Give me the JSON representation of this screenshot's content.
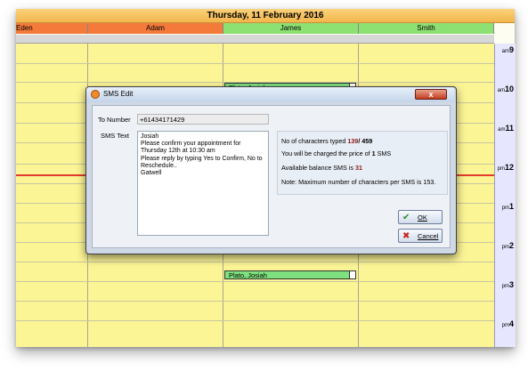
{
  "calendar": {
    "date_title": "Thursday, 11 February 2016",
    "staff": [
      {
        "name": "Eden",
        "color": "#f47a3c"
      },
      {
        "name": "Adam",
        "color": "#f47a3c"
      },
      {
        "name": "James",
        "color": "#8de072"
      },
      {
        "name": "Smith",
        "color": "#8de072"
      }
    ],
    "times": [
      {
        "ampm": "am",
        "hour": "9"
      },
      {
        "ampm": "am",
        "hour": "10"
      },
      {
        "ampm": "am",
        "hour": "11"
      },
      {
        "ampm": "pm",
        "hour": "12"
      },
      {
        "ampm": "pm",
        "hour": "1"
      },
      {
        "ampm": "pm",
        "hour": "2"
      },
      {
        "ampm": "pm",
        "hour": "3"
      },
      {
        "ampm": "pm",
        "hour": "4"
      }
    ],
    "appointments": [
      {
        "label": "Plato, Josiah"
      },
      {
        "label": "Plato, Josiah"
      }
    ]
  },
  "dialog": {
    "title": "SMS Edit",
    "close_label": "x",
    "to_number_label": "To Number",
    "to_number_value": "+61434171429",
    "sms_text_label": "SMS Text",
    "sms_text": "Josiah\nPlease confirm your appointment for Thursday 12th at 10:30 am\nPlease reply by typing Yes to Confirm, No to Reschedule..\nGatwell",
    "info": {
      "chars_label": "No of characters typed",
      "chars_typed": "139",
      "chars_max": "/ 459",
      "charge_prefix": "You will be charged the price of",
      "charge_count": "1",
      "charge_suffix": "SMS",
      "balance_label": "Available balance SMS is",
      "balance_value": "31",
      "note": "Note: Maximum number of characters per SMS is 153."
    },
    "ok_label": "OK",
    "cancel_label": "Cancel"
  }
}
